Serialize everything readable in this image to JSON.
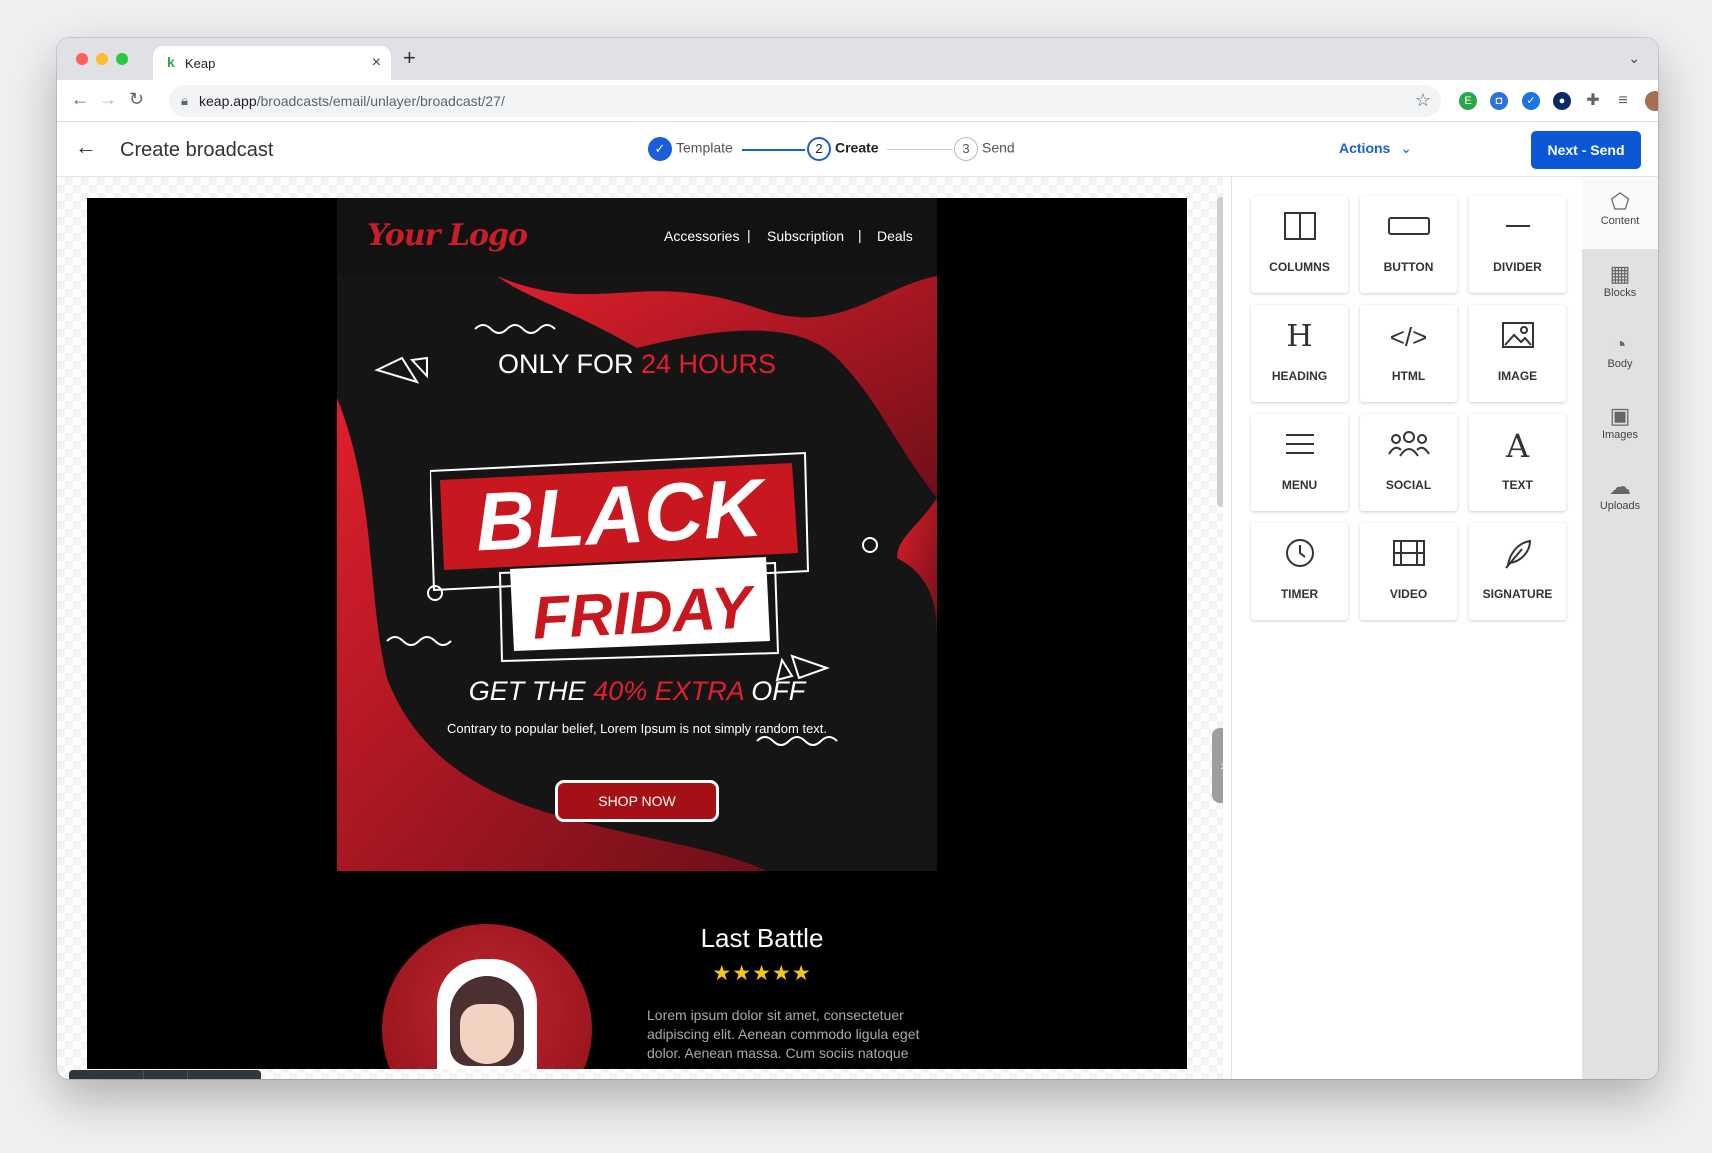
{
  "browser": {
    "tab_title": "Keap",
    "tab_favicon": "k",
    "tab_close": "×",
    "new_tab": "+",
    "url_host": "keap.app",
    "url_path": "/broadcasts/email/unlayer/broadcast/27/",
    "icons": [
      "back-icon",
      "forward-icon",
      "reload-icon",
      "lock-icon",
      "bookmark-star-icon",
      "evernote-icon",
      "extension-icon",
      "checkmark-extension-icon",
      "onepassword-icon",
      "puzzle-icon",
      "reading-list-icon",
      "profile-avatar",
      "kebab-menu-icon"
    ]
  },
  "app": {
    "page_title": "Create broadcast",
    "steps": [
      {
        "number": "1",
        "label": "Template",
        "state": "done"
      },
      {
        "number": "2",
        "label": "Create",
        "state": "active"
      },
      {
        "number": "3",
        "label": "Send",
        "state": "pending"
      }
    ],
    "actions_label": "Actions",
    "next_label": "Next - Send",
    "accent_color": "#0b57d6"
  },
  "email": {
    "logo_text": "Your Logo",
    "menu": [
      "Accessories",
      "Subscription",
      "Deals"
    ],
    "menu_separator": "|",
    "only_for_prefix": "ONLY FOR",
    "only_for_highlight": "24 HOURS",
    "banner_line1": "BLACK",
    "banner_line2": "FRIDAY",
    "offer_prefix": "GET THE",
    "offer_highlight": "40% EXTRA",
    "offer_suffix": "OFF",
    "tagline": "Contrary to popular belief, Lorem Ipsum is not simply random text.",
    "cta_label": "SHOP NOW",
    "product_title": "Last Battle",
    "rating": 5,
    "rating_text": "★★★★★",
    "product_desc": "Lorem ipsum dolor sit amet, consectetuer adipiscing elit. Aenean commodo ligula eget dolor. Aenean massa. Cum sociis natoque",
    "brand_red": "#e0202c"
  },
  "content_tools": [
    {
      "label": "COLUMNS",
      "icon": "columns-icon"
    },
    {
      "label": "BUTTON",
      "icon": "button-icon"
    },
    {
      "label": "DIVIDER",
      "icon": "divider-icon"
    },
    {
      "label": "HEADING",
      "icon": "heading-icon"
    },
    {
      "label": "HTML",
      "icon": "html-code-icon"
    },
    {
      "label": "IMAGE",
      "icon": "image-icon"
    },
    {
      "label": "MENU",
      "icon": "menu-icon"
    },
    {
      "label": "SOCIAL",
      "icon": "social-icon"
    },
    {
      "label": "TEXT",
      "icon": "text-icon"
    },
    {
      "label": "TIMER",
      "icon": "timer-icon"
    },
    {
      "label": "VIDEO",
      "icon": "video-icon"
    },
    {
      "label": "SIGNATURE",
      "icon": "signature-icon"
    }
  ],
  "side_tabs": [
    {
      "label": "Content",
      "icon": "shapes-icon",
      "active": true
    },
    {
      "label": "Blocks",
      "icon": "blocks-grid-icon",
      "active": false
    },
    {
      "label": "Body",
      "icon": "palette-icon",
      "active": false
    },
    {
      "label": "Images",
      "icon": "images-icon",
      "active": false
    },
    {
      "label": "Uploads",
      "icon": "cloud-upload-icon",
      "active": false
    }
  ],
  "bottom_tools": [
    "undo-icon",
    "redo-icon",
    "preview-eye-icon",
    "desktop-view-icon",
    "mobile-view-icon"
  ]
}
